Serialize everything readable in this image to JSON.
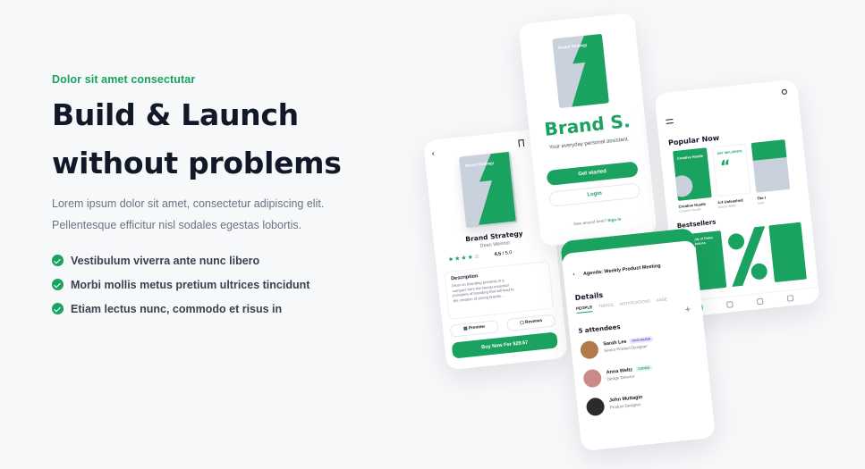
{
  "hero": {
    "eyebrow": "Dolor sit amet consectutar",
    "title_line1": "Build & Launch",
    "title_line2": "without problems",
    "lead_line1": "Lorem ipsum dolor sit amet, consectetur adipiscing elit.",
    "lead_line2": "Pellentesque efficitur nisl sodales egestas lobortis.",
    "checks": [
      "Vestibulum viverra ante nunc libero",
      "Morbi mollis metus pretium ultrices tincidunt",
      "Etiam lectus nunc, commodo et risus in"
    ]
  },
  "brand_screen": {
    "cover_title": "Brand Strategy",
    "brand_name": "Brand S.",
    "tagline": "Your everyday personal assistant.",
    "get_started": "Get started",
    "login": "Login",
    "foot_text": "New around here?",
    "foot_link": "Sign in"
  },
  "product_screen": {
    "cover_title": "Brand Strategy",
    "title": "Brand Strategy",
    "author": "Dean Weirnor",
    "stars": "★★★★☆",
    "rating": "4.5",
    "rating_max": "/ 5.0",
    "desc_heading": "Description",
    "desc_text": "Dean on Branding presents in a compact form the twenty essential principles of branding that will lead to the creation of strong brands....",
    "preview": "Preview",
    "reviews": "Reviews",
    "buy": "Buy Now For $29.67"
  },
  "meeting_screen": {
    "title": "Agenda: Weekly Product Meeting",
    "details": "Details",
    "tabs": [
      "PEOPLE",
      "TOPICS",
      "NOTIFICATIONS",
      "ASSE"
    ],
    "attendees": "5 attendees",
    "people": [
      {
        "name": "Sarah Lee",
        "role": "Senior Product Designer",
        "tag": "ORGANIZER",
        "avatar": "#b07a4a"
      },
      {
        "name": "Anna Weltz",
        "role": "Design Director",
        "tag": "COPIED",
        "avatar": "#c98a8a"
      },
      {
        "name": "John Muttagin",
        "role": "Product Designer",
        "tag": "",
        "avatar": "#2b2b2b"
      }
    ]
  },
  "library_screen": {
    "popular": "Popular Now",
    "book1_title": "Creative Hustle",
    "book1_sub": "Creative Hustle",
    "book2_title": "4:4 Unleashed",
    "book2_sub": "Simon Willis",
    "book3_title": "The I",
    "book3_sub": "Sara",
    "bestsellers": "Bestsellers",
    "best1": "The Study of Rules and Solutions",
    "art_label": "ART INFLUENCE"
  },
  "colors": {
    "accent": "#1aa260",
    "text": "#111827",
    "muted": "#6b7280",
    "background": "#f7f8fa"
  }
}
